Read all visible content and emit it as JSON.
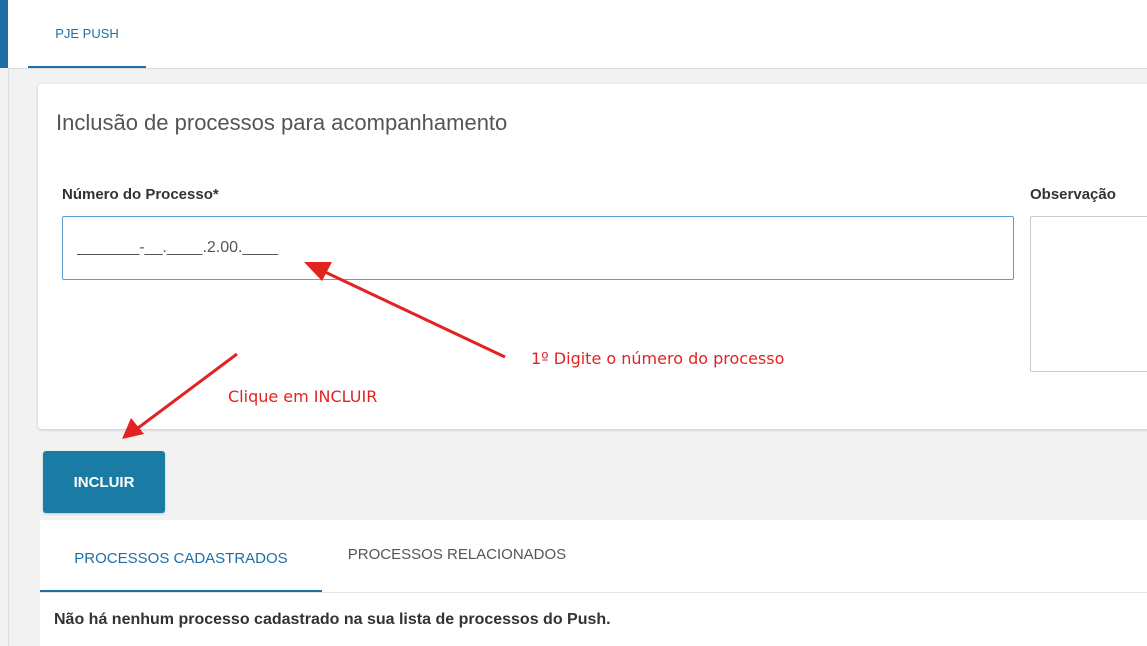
{
  "top_tab": {
    "label": "PJE PUSH"
  },
  "form": {
    "title": "Inclusão de processos para acompanhamento",
    "process_number_label": "Número do Processo*",
    "process_number_value": "_______-__.____.2.00.____",
    "observation_label": "Observação"
  },
  "annotations": {
    "step_1": "1º Digite o número do processo",
    "step_2": "Clique em INCLUIR"
  },
  "actions": {
    "include_label": "INCLUIR"
  },
  "results": {
    "tabs": [
      {
        "label": "PROCESSOS CADASTRADOS"
      },
      {
        "label": "PROCESSOS RELACIONADOS"
      }
    ],
    "empty_message": "Não há nenhum processo cadastrado na sua lista de processos do Push."
  },
  "colors": {
    "accent": "#1d6fa5",
    "button": "#1a7ba4",
    "annotation": "#e32222"
  }
}
